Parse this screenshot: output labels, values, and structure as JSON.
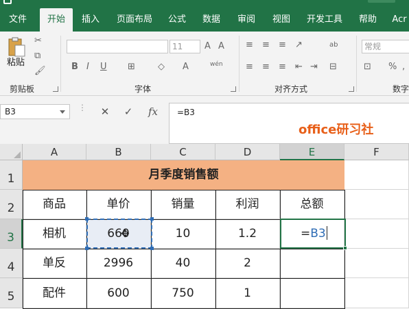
{
  "ribbon_tabs": [
    {
      "label": "文件",
      "active": false
    },
    {
      "label": "开始",
      "active": true
    },
    {
      "label": "插入",
      "active": false
    },
    {
      "label": "页面布局",
      "active": false
    },
    {
      "label": "公式",
      "active": false
    },
    {
      "label": "数据",
      "active": false
    },
    {
      "label": "审阅",
      "active": false
    },
    {
      "label": "视图",
      "active": false
    },
    {
      "label": "开发工具",
      "active": false
    },
    {
      "label": "帮助",
      "active": false
    },
    {
      "label": "Acr",
      "active": false
    }
  ],
  "ribbon": {
    "paste_label": "粘贴",
    "clipboard_label": "剪贴板",
    "font_label": "字体",
    "font_size": "11",
    "bold": "B",
    "italic": "I",
    "underline": "U",
    "wen_label": "wén",
    "alignment_label": "对齐方式",
    "number_format": "常规",
    "percent": "%",
    "number_label": "数字",
    "wrap_label": "ab"
  },
  "formula_bar": {
    "name_box": "B3",
    "cancel_glyph": "✕",
    "enter_glyph": "✓",
    "fx_glyph": "fx",
    "formula": "=B3",
    "watermark": "office研习社"
  },
  "columns": [
    "A",
    "B",
    "C",
    "D",
    "E",
    "F"
  ],
  "selected_column": "E",
  "rows": [
    "1",
    "2",
    "3",
    "4",
    "5"
  ],
  "selected_row": "3",
  "table": {
    "title": "月季度销售额",
    "headers": [
      "商品",
      "单价",
      "销量",
      "利润",
      "总额"
    ],
    "data": [
      [
        "相机",
        "660",
        "10",
        "1.2",
        ""
      ],
      [
        "单反",
        "2996",
        "40",
        "2",
        ""
      ],
      [
        "配件",
        "600",
        "750",
        "1",
        ""
      ]
    ]
  },
  "edit_cell": {
    "prefix": "=",
    "ref": "B3"
  }
}
